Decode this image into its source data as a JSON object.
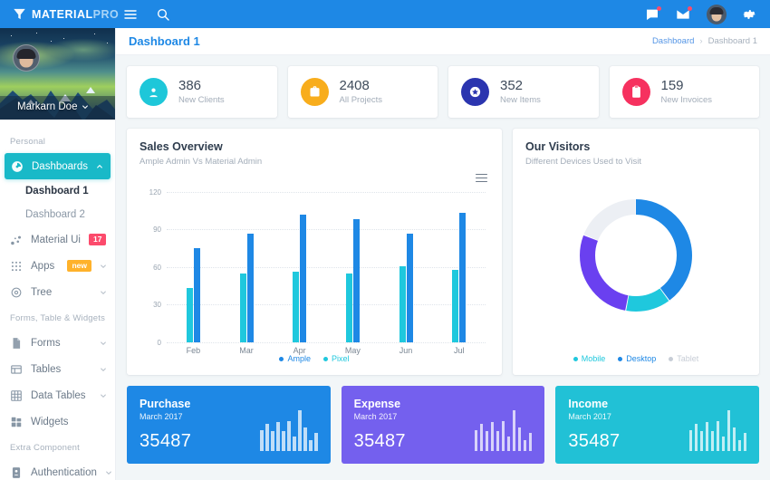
{
  "brand": {
    "strong": "MATERIAL",
    "light": "PRO"
  },
  "topbar": {
    "icons": [
      {
        "name": "hamburger-icon",
        "label": "Toggle navigation"
      },
      {
        "name": "search-icon",
        "label": "Search"
      }
    ],
    "right": [
      {
        "name": "comment-icon",
        "label": "Messages",
        "badge": true
      },
      {
        "name": "envelope-icon",
        "label": "Mail",
        "badge": true
      },
      {
        "name": "avatar",
        "label": "Profile"
      },
      {
        "name": "gear-icon",
        "label": "Settings"
      }
    ]
  },
  "sidebar": {
    "profile": {
      "name": "Markarn Doe",
      "caret": "chevron-down-icon"
    },
    "sections": [
      {
        "label": "Personal",
        "items": [
          {
            "label": "Dashboards",
            "icon": "dashboard-icon",
            "active": true,
            "caret": "chevron-up-icon",
            "children": [
              {
                "label": "Dashboard 1",
                "current": true
              },
              {
                "label": "Dashboard 2",
                "current": false
              }
            ]
          },
          {
            "label": "Material Ui",
            "icon": "bubbles-icon",
            "badge": {
              "text": "17",
              "color": "#fc4b6c"
            },
            "caret": "chevron-down-icon"
          },
          {
            "label": "Apps",
            "icon": "grid-dots-icon",
            "badge": {
              "text": "new",
              "color": "#ffb22b"
            },
            "caret": "chevron-down-icon"
          },
          {
            "label": "Tree",
            "icon": "cog-icon",
            "caret": "chevron-down-icon"
          }
        ]
      },
      {
        "label": "Forms, Table & Widgets",
        "items": [
          {
            "label": "Forms",
            "icon": "file-icon",
            "caret": "chevron-down-icon"
          },
          {
            "label": "Tables",
            "icon": "table-icon",
            "caret": "chevron-down-icon"
          },
          {
            "label": "Data Tables",
            "icon": "grid-table-icon",
            "caret": "chevron-down-icon"
          },
          {
            "label": "Widgets",
            "icon": "widgets-icon"
          }
        ]
      },
      {
        "label": "Extra Component",
        "items": [
          {
            "label": "Authentication",
            "icon": "id-card-icon",
            "caret": "chevron-down-icon"
          }
        ]
      }
    ]
  },
  "page": {
    "title": "Dashboard 1",
    "breadcrumb": {
      "root": "Dashboard",
      "separator": "›",
      "current": "Dashboard 1"
    }
  },
  "stats": [
    {
      "value": "386",
      "label": "New Clients",
      "icon": "user-circle-icon",
      "color": "#1ec7d9"
    },
    {
      "value": "2408",
      "label": "All Projects",
      "icon": "briefcase-icon",
      "color": "#f8ad1c"
    },
    {
      "value": "352",
      "label": "New Items",
      "icon": "star-badge-icon",
      "color": "#2b35af"
    },
    {
      "value": "159",
      "label": "New Invoices",
      "icon": "clipboard-icon",
      "color": "#f6315f"
    }
  ],
  "chart_data": [
    {
      "type": "bar",
      "title": "Sales Overview",
      "subtitle": "Ample Admin Vs Material Admin",
      "categories": [
        "Feb",
        "Mar",
        "Apr",
        "May",
        "Jun",
        "Jul"
      ],
      "series": [
        {
          "name": "Ample",
          "color": "#1e88e5",
          "values": [
            75,
            87,
            102,
            98,
            87,
            103
          ]
        },
        {
          "name": "Pixel",
          "color": "#1fc8dd",
          "values": [
            43,
            55,
            56,
            55,
            61,
            58
          ]
        }
      ],
      "yticks": [
        0,
        30,
        60,
        90,
        120
      ],
      "ylim": [
        0,
        130
      ],
      "xlabel": "",
      "ylabel": "",
      "grid": true,
      "legend_position": "bottom",
      "menu_icon": "hamburger-menu-icon"
    },
    {
      "type": "pie",
      "title": "Our Visitors",
      "subtitle": "Different Devices Used to Visit",
      "donut": true,
      "labels": [
        "Desktop",
        "Mobile",
        "Tablet"
      ],
      "slices": [
        {
          "name": "Desktop",
          "color": "#1e88e5",
          "value": 40
        },
        {
          "name": "Mobile",
          "color": "#1fc8dd",
          "value": 13
        },
        {
          "name": "Purple",
          "color": "#6a40f0",
          "value": 28
        },
        {
          "name": "Tablet",
          "color": "#eceff4",
          "value": 19
        }
      ],
      "legend": [
        {
          "name": "Mobile",
          "color": "#1fc8dd"
        },
        {
          "name": "Desktop",
          "color": "#1e88e5"
        },
        {
          "name": "Tablet",
          "color": "#c7cdd6"
        }
      ],
      "legend_position": "bottom"
    }
  ],
  "mini_cards": [
    {
      "title": "Purchase",
      "date": "March 2017",
      "value": "35487",
      "color": "#1e88e5",
      "spark": [
        52,
        66,
        48,
        72,
        50,
        74,
        36,
        100,
        58,
        26,
        44
      ]
    },
    {
      "title": "Expense",
      "date": "March 2017",
      "value": "35487",
      "color": "#7460ee",
      "spark": [
        52,
        66,
        48,
        72,
        50,
        74,
        36,
        100,
        58,
        26,
        44
      ]
    },
    {
      "title": "Income",
      "date": "March 2017",
      "value": "35487",
      "color": "#21c1d6",
      "spark": [
        52,
        66,
        48,
        72,
        50,
        74,
        36,
        100,
        58,
        26,
        44
      ]
    }
  ]
}
